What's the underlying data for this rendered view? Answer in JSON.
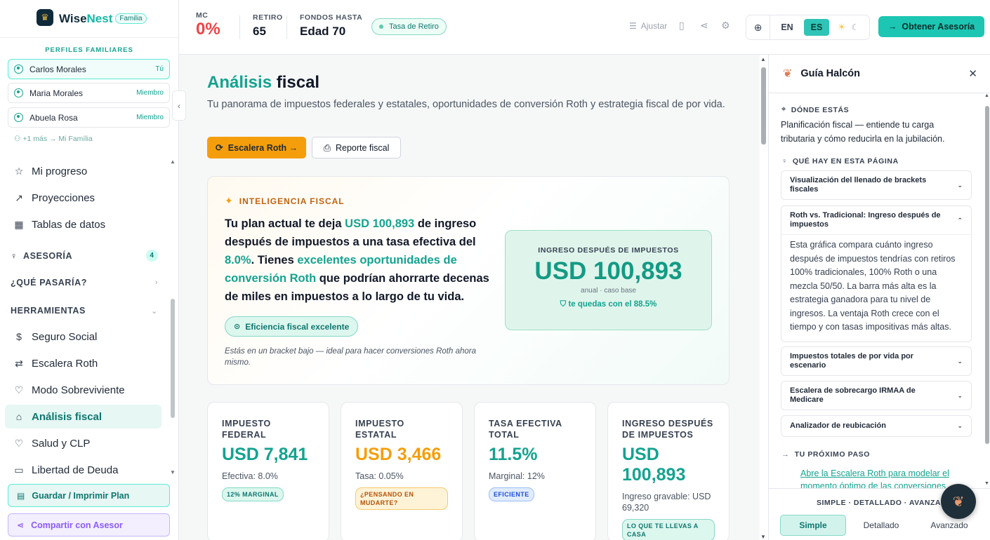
{
  "brand": {
    "name_a": "Wise",
    "name_b": "Nest",
    "badge": "Familia",
    "logo_icon": "eagle-logo"
  },
  "family": {
    "title": "PERFILES FAMILIARES",
    "members": [
      {
        "name": "Carlos Morales",
        "tag": "Tú"
      },
      {
        "name": "Maria Morales",
        "tag": "Miembro"
      },
      {
        "name": "Abuela Rosa",
        "tag": "Miembro"
      }
    ],
    "more": "+1 más → Mi Família"
  },
  "nav": {
    "progreso": "Mi progreso",
    "proyecciones": "Proyecciones",
    "tablas": "Tablas de datos",
    "asesoria": "ASESORÍA",
    "asesoria_count": "4",
    "que_pasaria": "¿QUÉ PASARÍA?",
    "herramientas": "HERRAMIENTAS",
    "seguro": "Seguro Social",
    "escalera": "Escalera Roth",
    "modo": "Modo Sobreviviente",
    "analisis": "Análisis fiscal",
    "salud": "Salud y CLP",
    "libertad": "Libertad de Deuda"
  },
  "sidebar_buttons": {
    "save": "Guardar / Imprimir Plan",
    "share": "Compartir con Asesor"
  },
  "topbar": {
    "mc_label": "MC",
    "mc_value": "0%",
    "retiro_label": "RETIRO",
    "retiro_value": "65",
    "fondos_label": "FONDOS HASTA",
    "fondos_value": "Edad 70",
    "rate_pill": "Tasa de Retiro",
    "ajustar": "Ajustar",
    "lang_en": "EN",
    "lang_es": "ES",
    "cta": "Obtener Asesoría"
  },
  "page": {
    "title_accent": "Análisis",
    "title_rest": "fiscal",
    "subtitle": "Tu panorama de impuestos federales y estatales, oportunidades de conversión Roth y estrategia fiscal de por vida.",
    "btn_roth": "Escalera Roth →",
    "btn_report": "Reporte fiscal"
  },
  "intel": {
    "tag": "INTELIGENCIA FISCAL",
    "t1": "Tu plan actual te deja ",
    "t2": "USD 100,893",
    "t3": " de ingreso después de impuestos a una tasa efectiva del ",
    "t4": "8.0%",
    "t5": ". Tienes ",
    "t6": "excelentes oportunidades de conversión Roth",
    "t7": " que podrían ahorrarte decenas de miles en impuestos a lo largo de tu vida.",
    "pill": "Eficiencia fiscal excelente",
    "note": "Estás en un bracket bajo — ideal para hacer conversiones Roth ahora mismo.",
    "card_label": "INGRESO DESPUÉS DE IMPUESTOS",
    "card_value": "USD 100,893",
    "card_sub": "anual · caso base",
    "card_keep": "te quedas con el 88.5%"
  },
  "metrics": [
    {
      "title": "IMPUESTO FEDERAL",
      "value": "USD 7,841",
      "sub": "Efectiva: 8.0%",
      "badge": "12% MARGINAL",
      "color": "#14a38f"
    },
    {
      "title": "IMPUESTO ESTATAL",
      "value": "USD 3,466",
      "sub": "Tasa: 0.05%",
      "badge": "¿PENSANDO EN MUDARTE?",
      "color": "#f59e0b"
    },
    {
      "title": "TASA EFECTIVA TOTAL",
      "value": "11.5%",
      "sub": "Marginal: 12%",
      "badge": "EFICIENTE",
      "color": "#14a38f"
    },
    {
      "title": "INGRESO DESPUÉS DE IMPUESTOS",
      "value": "USD 100,893",
      "sub": "Ingreso gravable: USD 69,320",
      "badge": "LO QUE TE LLEVAS A CASA",
      "color": "#14a38f"
    }
  ],
  "guide": {
    "title": "Guía Halcón",
    "where_label": "DÓNDE ESTÁS",
    "where_text": "Planificación fiscal — entiende tu carga tributaria y cómo reducirla en la jubilación.",
    "what_label": "QUÉ HAY EN ESTA PÁGINA",
    "items": [
      "Visualización del llenado de brackets fiscales",
      "Roth vs. Tradicional: Ingreso después de impuestos",
      "Impuestos totales de por vida por escenario",
      "Escalera de sobrecargo IRMAA de Medicare",
      "Analizador de reubicación"
    ],
    "item_body": "Esta gráfica compara cuánto ingreso después de impuestos tendrías con retiros 100% tradicionales, 100% Roth o una mezcla 50/50. La barra más alta es la estrategia ganadora para tu nivel de ingresos. La ventaja Roth crece con el tiempo y con tasas impositivas más altas.",
    "next_label": "TU PRÓXIMO PASO",
    "next_link": "Abre la Escalera Roth para modelar el momento óptimo de las conversiones",
    "mode_label": "SIMPLE · DETALLADO · AVANZADO",
    "mode_simple": "Simple",
    "mode_detallado": "Detallado",
    "mode_avanzado": "Avanzado"
  }
}
